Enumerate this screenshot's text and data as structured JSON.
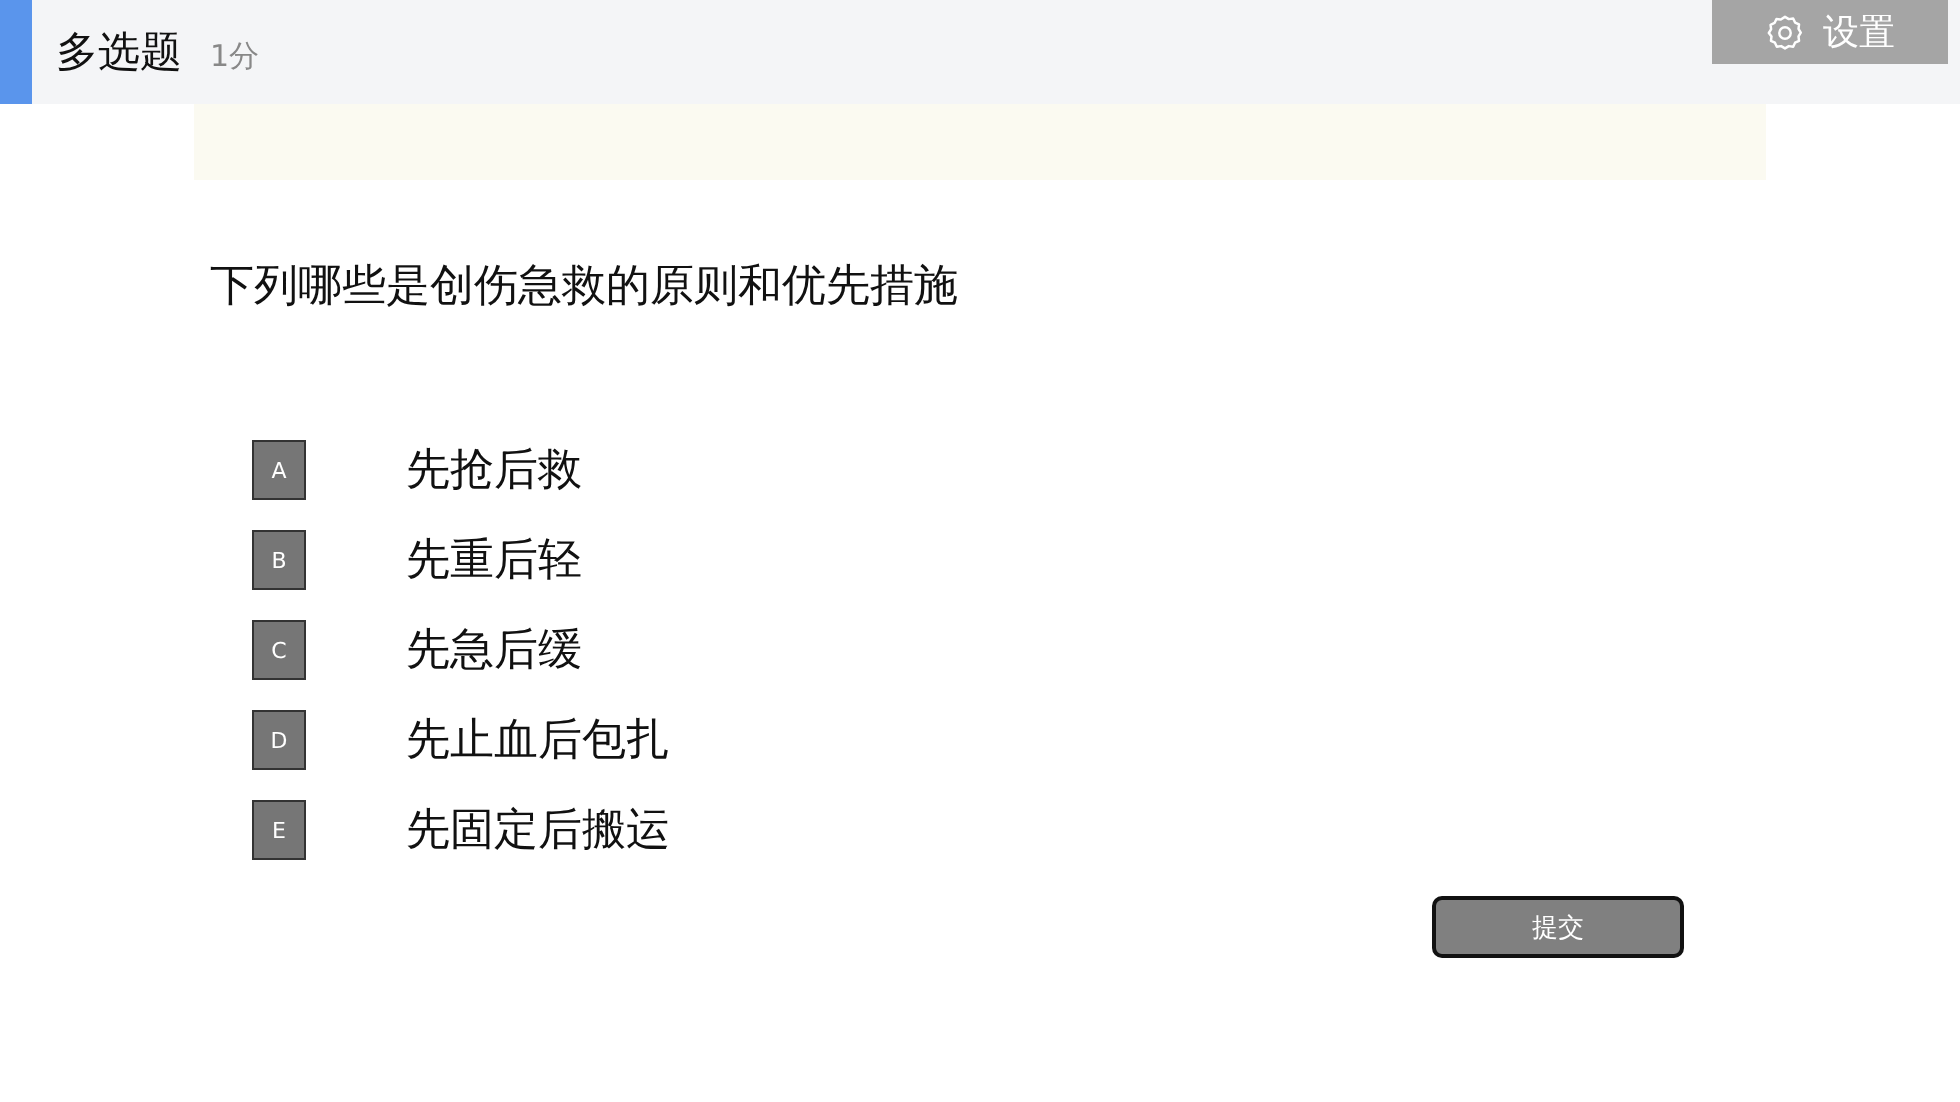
{
  "header": {
    "title": "多选题",
    "score": "1分",
    "settings_button": "设置"
  },
  "question": "下列哪些是创伤急救的原则和优先措施",
  "options": [
    {
      "letter": "A",
      "text": "先抢后救",
      "selected": false
    },
    {
      "letter": "B",
      "text": "先重后轻",
      "selected": false
    },
    {
      "letter": "C",
      "text": "先急后缓",
      "selected": false
    },
    {
      "letter": "D",
      "text": "先止血后包扎",
      "selected": false
    },
    {
      "letter": "E",
      "text": "先固定后搬运",
      "selected": false
    }
  ],
  "submit_button": "提交"
}
